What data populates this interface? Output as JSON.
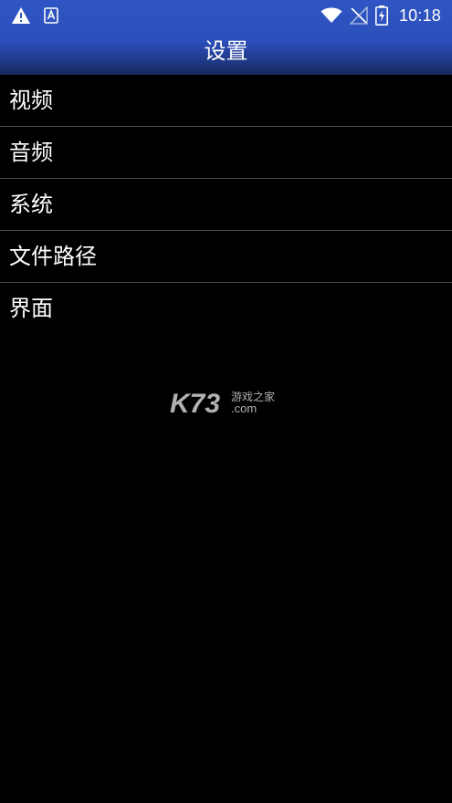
{
  "status_bar": {
    "time": "10:18",
    "icons": [
      "warning-icon",
      "keyboard-a-icon",
      "wifi-icon",
      "no-signal-icon",
      "battery-charging-icon"
    ]
  },
  "header": {
    "title": "设置"
  },
  "settings_list": {
    "items": [
      {
        "label": "视频"
      },
      {
        "label": "音频"
      },
      {
        "label": "系统"
      },
      {
        "label": "文件路径"
      },
      {
        "label": "界面"
      }
    ]
  },
  "watermark": {
    "brand": "K73",
    "tagline": "游戏之家",
    "domain": ".com"
  },
  "colors": {
    "header_top": "#2f55c4",
    "header_bottom": "#15265c",
    "background": "#000000",
    "divider": "#4a4a4a",
    "text": "#ffffff"
  }
}
